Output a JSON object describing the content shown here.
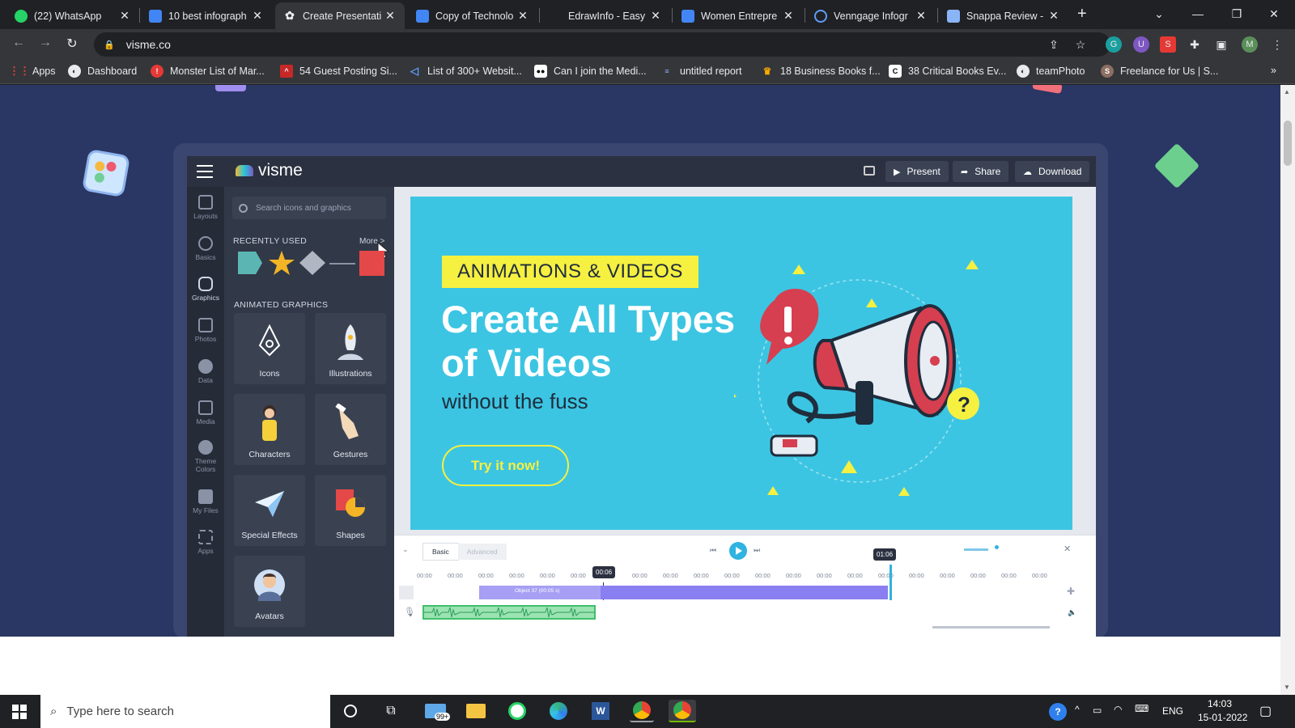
{
  "browser": {
    "tabs": [
      {
        "label": "(22) WhatsApp",
        "icon": "whatsapp-icon",
        "color": "#25d366"
      },
      {
        "label": "10 best infograph",
        "icon": "docs-icon",
        "color": "#4285f4"
      },
      {
        "label": "Create Presentati",
        "icon": "visme-icon",
        "color": "#9aa0a6",
        "active": true
      },
      {
        "label": "Copy of Technolo",
        "icon": "docs-icon",
        "color": "#4285f4"
      },
      {
        "label": "EdrawInfo - Easy",
        "icon": "edraw-icon",
        "color": "#202124"
      },
      {
        "label": "Women Entrepre",
        "icon": "docs-icon",
        "color": "#4285f4"
      },
      {
        "label": "Venngage Infogr",
        "icon": "venngage-icon",
        "color": "#5f9cf8"
      },
      {
        "label": "Snappa Review -",
        "icon": "snappa-icon",
        "color": "#8ab4f8"
      }
    ],
    "url": "visme.co",
    "profile_initial": "M",
    "bookmarks": [
      {
        "label": "Apps",
        "icon": "apps-grid-icon"
      },
      {
        "label": "Dashboard",
        "icon": "globe-icon"
      },
      {
        "label": "Monster List of Mar...",
        "icon": "bookmark-red-icon"
      },
      {
        "label": "54 Guest Posting Si...",
        "icon": "bookmark-red-icon"
      },
      {
        "label": "List of 300+ Websit...",
        "icon": "bookmark-blue-icon"
      },
      {
        "label": "Can I join the Medi...",
        "icon": "medium-icon"
      },
      {
        "label": "untitled report",
        "icon": "report-icon"
      },
      {
        "label": "18 Business Books f...",
        "icon": "crown-icon"
      },
      {
        "label": "38 Critical Books Ev...",
        "icon": "c-icon"
      },
      {
        "label": "teamPhoto",
        "icon": "globe-icon"
      },
      {
        "label": "Freelance for Us | S...",
        "icon": "s-icon"
      }
    ]
  },
  "app": {
    "logo_text": "visme",
    "top_buttons": {
      "present": "Present",
      "share": "Share",
      "download": "Download"
    },
    "rail": [
      {
        "label": "Layouts",
        "icon": "layouts-icon"
      },
      {
        "label": "Basics",
        "icon": "basics-icon"
      },
      {
        "label": "Graphics",
        "icon": "graphics-icon",
        "active": true
      },
      {
        "label": "Photos",
        "icon": "photos-icon"
      },
      {
        "label": "Data",
        "icon": "data-icon"
      },
      {
        "label": "Media",
        "icon": "media-icon"
      },
      {
        "label": "Theme Colors",
        "icon": "palette-icon"
      },
      {
        "label": "My Files",
        "icon": "files-icon"
      },
      {
        "label": "Apps",
        "icon": "apps-icon"
      }
    ],
    "panel": {
      "search_placeholder": "Search icons and graphics",
      "recent_title": "RECENTLY USED",
      "more": "More >",
      "animated_title": "ANIMATED GRAPHICS",
      "tiles": [
        "Icons",
        "Illustrations",
        "Characters",
        "Gestures",
        "Special Effects",
        "Shapes",
        "Avatars"
      ]
    },
    "slide": {
      "badge": "ANIMATIONS & VIDEOS",
      "headline": "Create All Types of Videos",
      "subhead": "without the fuss",
      "cta": "Try it now!"
    },
    "timeline": {
      "tabs": [
        "Basic",
        "Advanced"
      ],
      "ticks": "00:00",
      "current_time": "00:06",
      "end_time": "01:06",
      "track_label": "Object 37 (00:05 s)"
    }
  },
  "taskbar": {
    "search_placeholder": "Type here to search",
    "mail_badge": "99+",
    "lang": "ENG",
    "time": "14:03",
    "date": "15-01-2022"
  }
}
